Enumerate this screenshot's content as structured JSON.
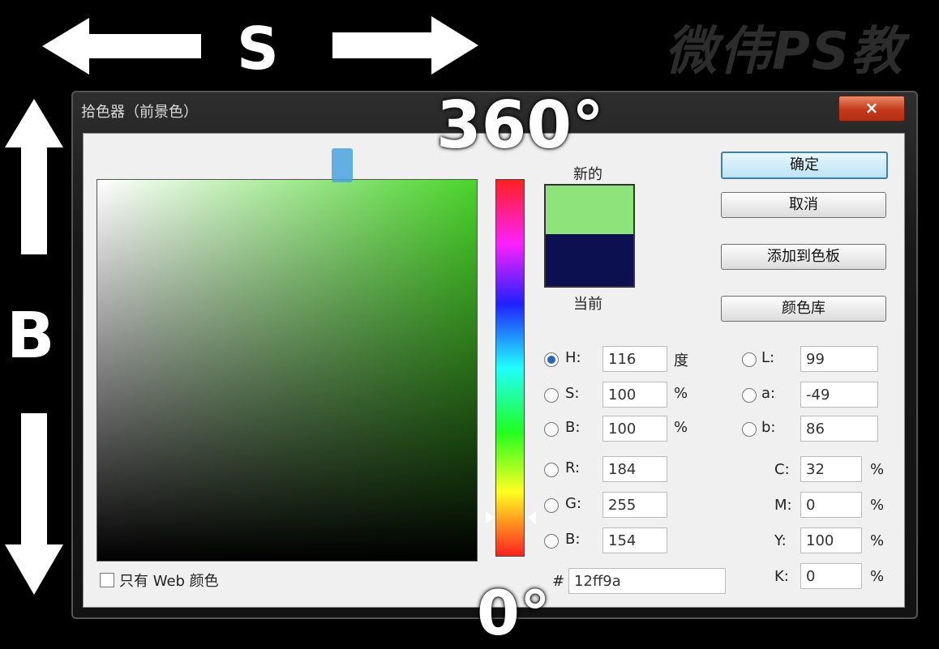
{
  "overlay": {
    "s_label": "S",
    "b_label": "B",
    "top_degree": "360°",
    "bottom_degree": "0°",
    "watermark": "微伟PS教"
  },
  "dialog": {
    "title": "拾色器（前景色）",
    "close": "×",
    "swatch_new_label": "新的",
    "swatch_current_label": "当前",
    "colors": {
      "new": "#8ee47a",
      "current": "#0c1050",
      "field_hue": "#4ad42a"
    },
    "buttons": {
      "ok": "确定",
      "cancel": "取消",
      "add_to_swatches": "添加到色板",
      "color_libraries": "颜色库"
    },
    "web_only_label": "只有 Web 颜色",
    "hsb": {
      "h_label": "H:",
      "h_value": "116",
      "h_unit": "度",
      "s_label": "S:",
      "s_value": "100",
      "s_unit": "%",
      "b_label": "B:",
      "b_value": "100",
      "b_unit": "%"
    },
    "rgb": {
      "r_label": "R:",
      "r_value": "184",
      "g_label": "G:",
      "g_value": "255",
      "b_label": "B:",
      "b_value": "154"
    },
    "lab": {
      "l_label": "L:",
      "l_value": "99",
      "a_label": "a:",
      "a_value": "-49",
      "b_label": "b:",
      "b_value": "86"
    },
    "cmyk": {
      "c_label": "C:",
      "c_value": "32",
      "c_unit": "%",
      "m_label": "M:",
      "m_value": "0",
      "m_unit": "%",
      "y_label": "Y:",
      "y_value": "100",
      "y_unit": "%",
      "k_label": "K:",
      "k_value": "0",
      "k_unit": "%"
    },
    "hex": {
      "label": "#",
      "value": "12ff9a"
    }
  }
}
